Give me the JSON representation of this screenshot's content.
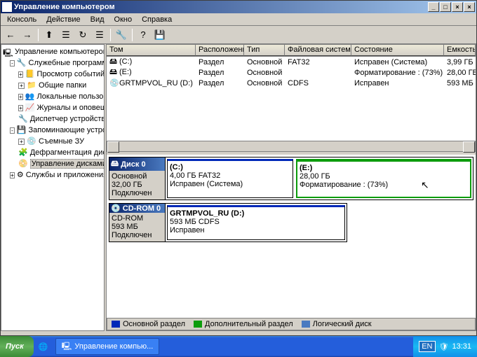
{
  "window": {
    "title": "Управление компьютером"
  },
  "win_btns": {
    "min": "_",
    "max": "□",
    "close": "×"
  },
  "menu": [
    "Консоль",
    "Действие",
    "Вид",
    "Окно",
    "Справка"
  ],
  "tree": {
    "root": "Управление компьютером (локал",
    "sys_tools": "Служебные программы",
    "event_viewer": "Просмотр событий",
    "shared": "Общие папки",
    "users": "Локальные пользователи",
    "perf": "Журналы и оповещения п",
    "devmgr": "Диспетчер устройств",
    "storage": "Запоминающие устройства",
    "removable": "Съемные ЗУ",
    "defrag": "Дефрагментация диска",
    "diskmgmt": "Управление дисками",
    "services": "Службы и приложения"
  },
  "columns": [
    "Том",
    "Расположение",
    "Тип",
    "Файловая система",
    "Состояние",
    "Емкость"
  ],
  "volumes": [
    {
      "name": "(C:)",
      "layout": "Раздел",
      "type": "Основной",
      "fs": "FAT32",
      "status": "Исправен (Система)",
      "cap": "3,99 ГБ"
    },
    {
      "name": "(E:)",
      "layout": "Раздел",
      "type": "Основной",
      "fs": "",
      "status": "Форматирование : (73%)",
      "cap": "28,00 ГБ"
    },
    {
      "name": "GRTMPVOL_RU (D:)",
      "layout": "Раздел",
      "type": "Основной",
      "fs": "CDFS",
      "status": "Исправен",
      "cap": "593 МБ"
    }
  ],
  "disk0": {
    "title": "Диск 0",
    "type": "Основной",
    "size": "32,00 ГБ",
    "state": "Подключен",
    "parts": [
      {
        "label": "(C:)",
        "line2": "4,00 ГБ FAT32",
        "line3": "Исправен (Система)"
      },
      {
        "label": "(E:)",
        "line2": "28,00 ГБ",
        "line3": "Форматирование : (73%)"
      }
    ]
  },
  "cdrom": {
    "title": "CD-ROM 0",
    "type": "CD-ROM",
    "size": "593 МБ",
    "state": "Подключен",
    "part": {
      "label": "GRTMPVOL_RU (D:)",
      "line2": "593 МБ CDFS",
      "line3": "Исправен"
    }
  },
  "legend": {
    "primary": "Основной раздел",
    "extended": "Дополнительный раздел",
    "logical": "Логический диск"
  },
  "colors": {
    "primary": "#0028b8",
    "extended": "#0c9c0c",
    "logical": "#4a7ac0"
  },
  "taskbar": {
    "start": "Пуск",
    "app": "Управление компью...",
    "lang": "EN",
    "time": "13:31"
  },
  "icons": {
    "computer": "🖳",
    "folder": "📁",
    "book": "📒",
    "users": "👥",
    "chart": "📈",
    "device": "🔧",
    "storage": "💾",
    "removable": "💿",
    "defrag": "🧩",
    "disk": "📀",
    "gear": "⚙",
    "hdd": "🖴",
    "cd": "💿",
    "back": "←",
    "fwd": "→",
    "up": "⬆",
    "props": "☰",
    "refresh": "↻",
    "help": "?",
    "shield": "🛡"
  }
}
